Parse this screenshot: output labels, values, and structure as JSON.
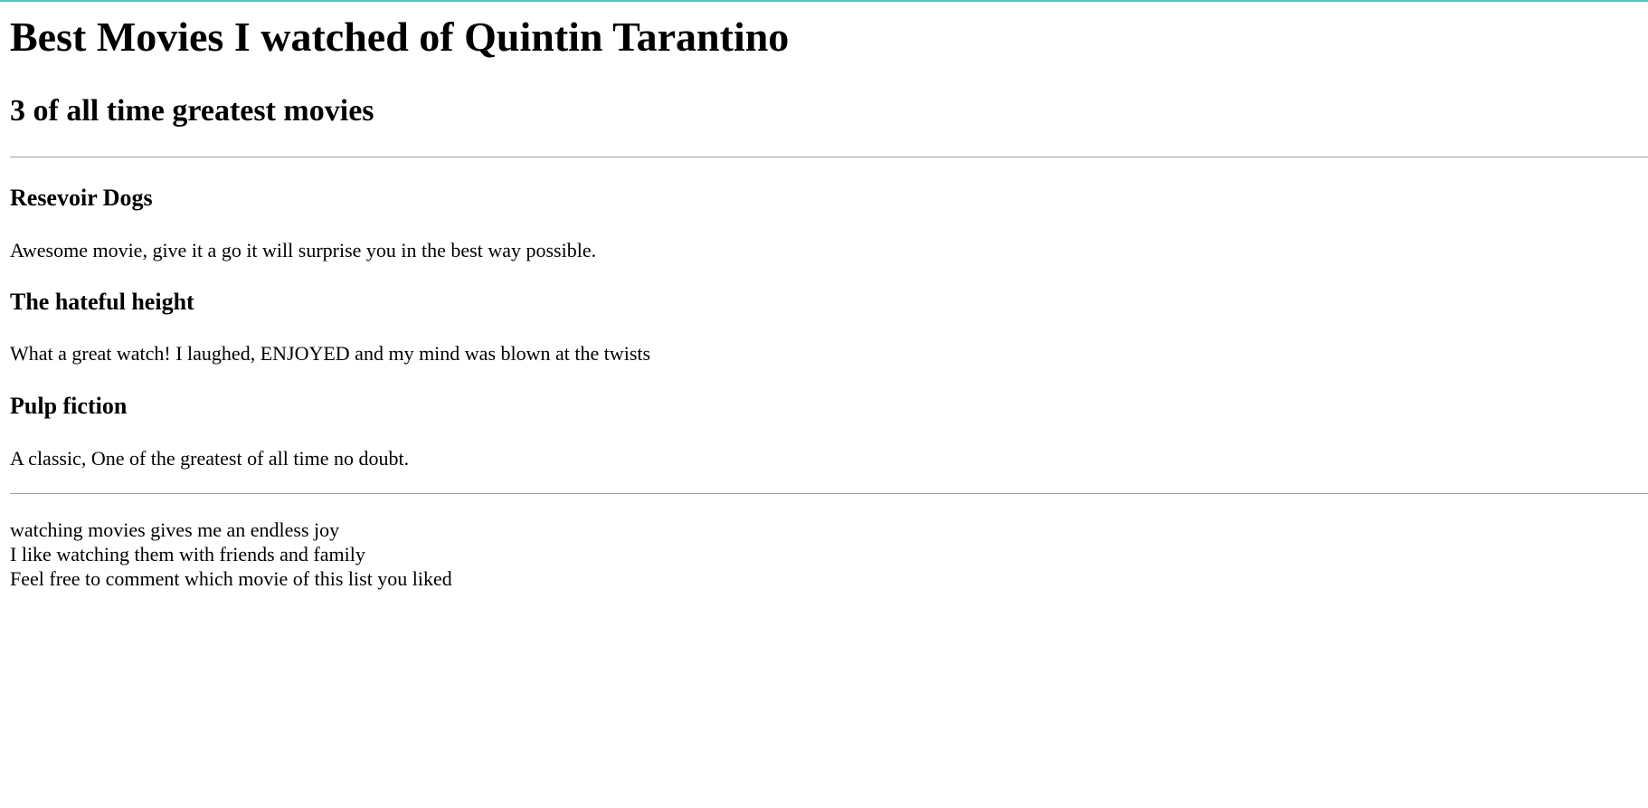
{
  "header": {
    "title": "Best Movies I watched of Quintin Tarantino",
    "subtitle": "3 of all time greatest movies"
  },
  "movies": [
    {
      "title": "Resevoir Dogs",
      "review": "Awesome movie, give it a go it will surprise you in the best way possible."
    },
    {
      "title": "The hateful height",
      "review": "What a great watch! I laughed, ENJOYED and my mind was blown at the twists"
    },
    {
      "title": "Pulp fiction",
      "review": "A classic, One of the greatest of all time no doubt."
    }
  ],
  "footer": {
    "lines": [
      "watching movies gives me an endless joy",
      "I like watching them with friends and family",
      "Feel free to comment which movie of this list you liked"
    ]
  },
  "colors": {
    "accent_bar": "#5bc4bf",
    "divider": "#a0a0a0",
    "text": "#000000",
    "background": "#ffffff"
  }
}
